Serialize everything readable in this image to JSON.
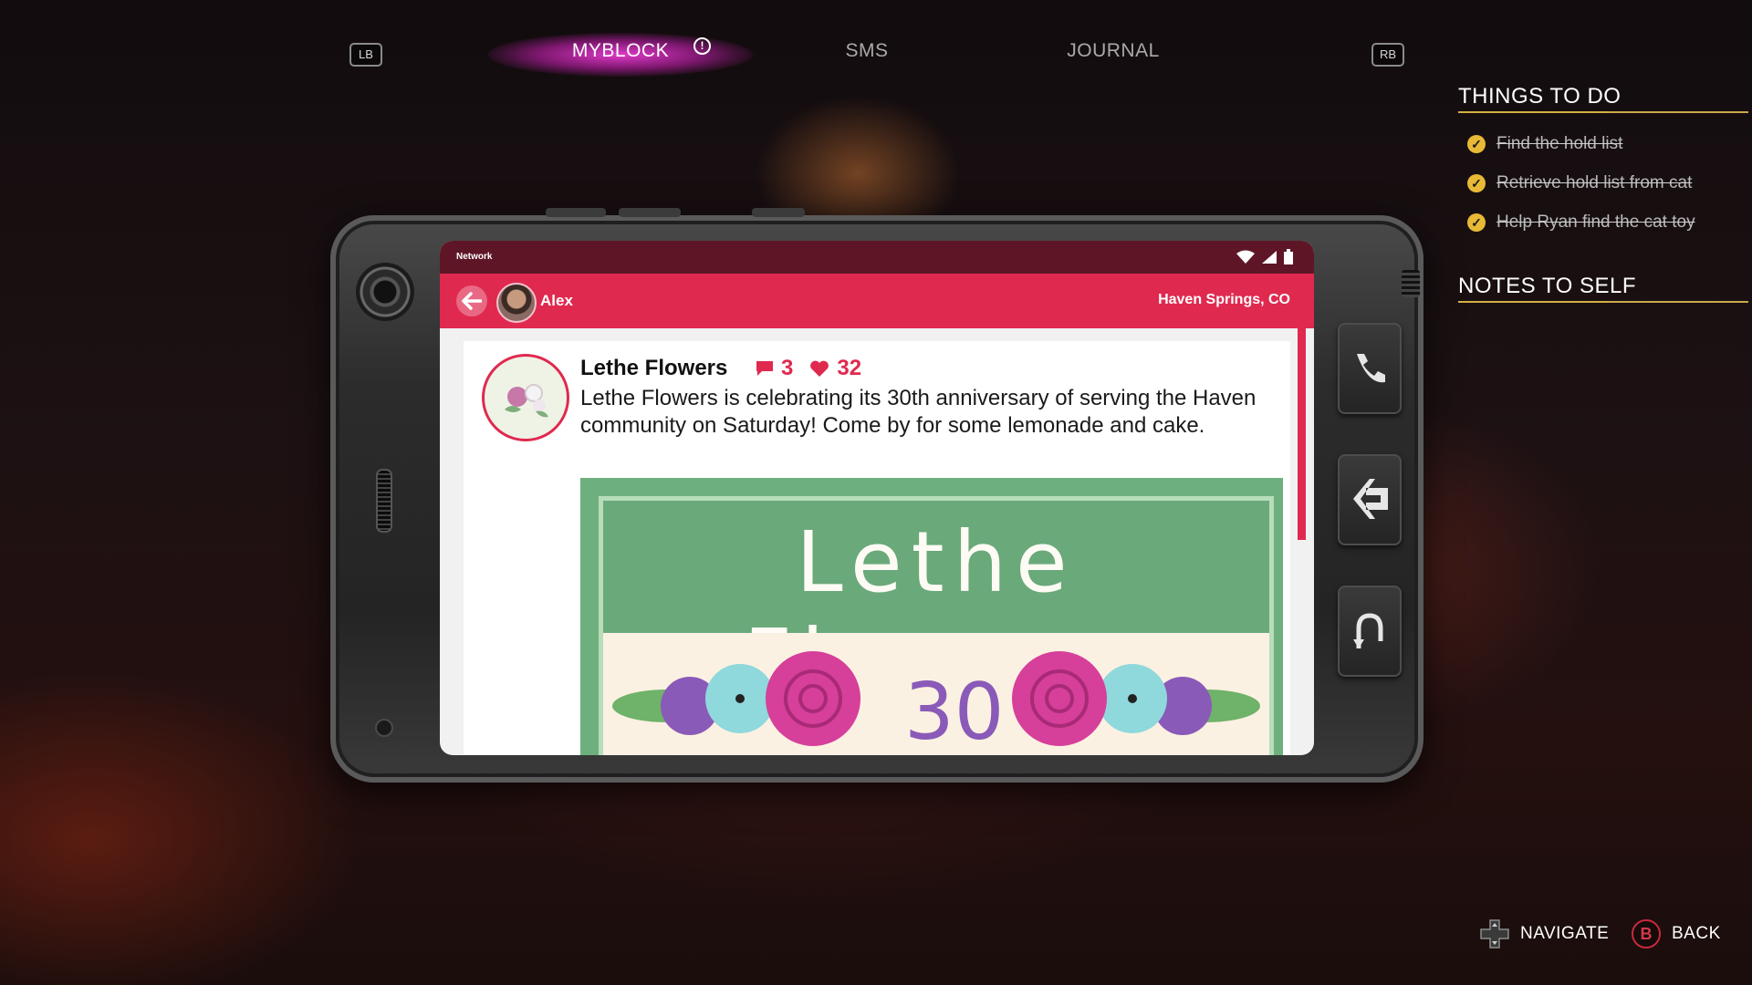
{
  "tabs": {
    "left_button": "LB",
    "right_button": "RB",
    "items": [
      {
        "label": "MYBLOCK",
        "active": true,
        "alert": "!"
      },
      {
        "label": "SMS",
        "active": false
      },
      {
        "label": "JOURNAL",
        "active": false
      }
    ]
  },
  "phone": {
    "status_label": "Network",
    "user_name": "Alex",
    "location": "Haven Springs, CO",
    "post": {
      "author": "Lethe Flowers",
      "comments": "3",
      "likes": "32",
      "text": "Lethe Flowers is celebrating its 30th anniversary of serving the Haven community on Saturday! Come by for some lemonade and cake.",
      "image_title": "Lethe Flowers",
      "image_number": "30"
    },
    "side_buttons": [
      "phone-icon",
      "exit-icon",
      "return-icon"
    ]
  },
  "things_to_do": {
    "heading": "THINGS TO DO",
    "items": [
      {
        "label": "Find the hold list",
        "done": true
      },
      {
        "label": "Retrieve hold list from cat",
        "done": true
      },
      {
        "label": "Help Ryan find the cat toy",
        "done": true
      }
    ]
  },
  "notes": {
    "heading": "NOTES TO SELF"
  },
  "hints": {
    "navigate": "NAVIGATE",
    "back_button": "B",
    "back": "BACK"
  },
  "colors": {
    "accent": "#e0294f",
    "status_bar": "#5e1626",
    "tab_glow": "#e83cd2",
    "check": "#e8b935"
  }
}
